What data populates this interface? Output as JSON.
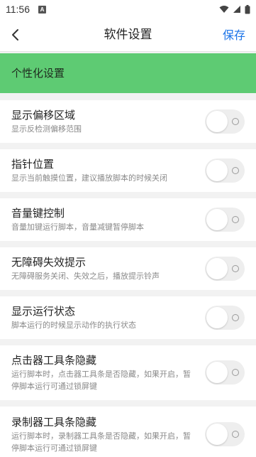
{
  "status_bar": {
    "time": "11:56",
    "notif_letter": "A"
  },
  "app_bar": {
    "title": "软件设置",
    "save_label": "保存"
  },
  "section": {
    "title": "个性化设置"
  },
  "settings": [
    {
      "title": "显示偏移区域",
      "desc": "显示反检测偏移范围",
      "enabled": false
    },
    {
      "title": "指针位置",
      "desc": "显示当前触摸位置，建议播放脚本的时候关闭",
      "enabled": false
    },
    {
      "title": "音量键控制",
      "desc": "音量加键运行脚本，音量减键暂停脚本",
      "enabled": false
    },
    {
      "title": "无障碍失效提示",
      "desc": "无障碍服务关闭、失效之后，播放提示铃声",
      "enabled": false
    },
    {
      "title": "显示运行状态",
      "desc": "脚本运行的时候显示动作的执行状态",
      "enabled": false
    },
    {
      "title": "点击器工具条隐藏",
      "desc": "运行脚本时，点击器工具条是否隐藏，如果开启，暂停脚本运行可通过锁屏键",
      "enabled": false
    },
    {
      "title": "录制器工具条隐藏",
      "desc": "运行脚本时，录制器工具条是否隐藏，如果开启，暂停脚本运行可通过锁屏键",
      "enabled": false
    }
  ],
  "icons": {
    "back": "chevron-left-icon",
    "wifi": "wifi-icon",
    "signal": "cellular-signal-icon",
    "battery": "battery-icon",
    "notification": "notification-a-icon"
  },
  "colors": {
    "accent": "#5ecb73",
    "link": "#1a73e8",
    "toggle_off": "#eeeeee"
  }
}
